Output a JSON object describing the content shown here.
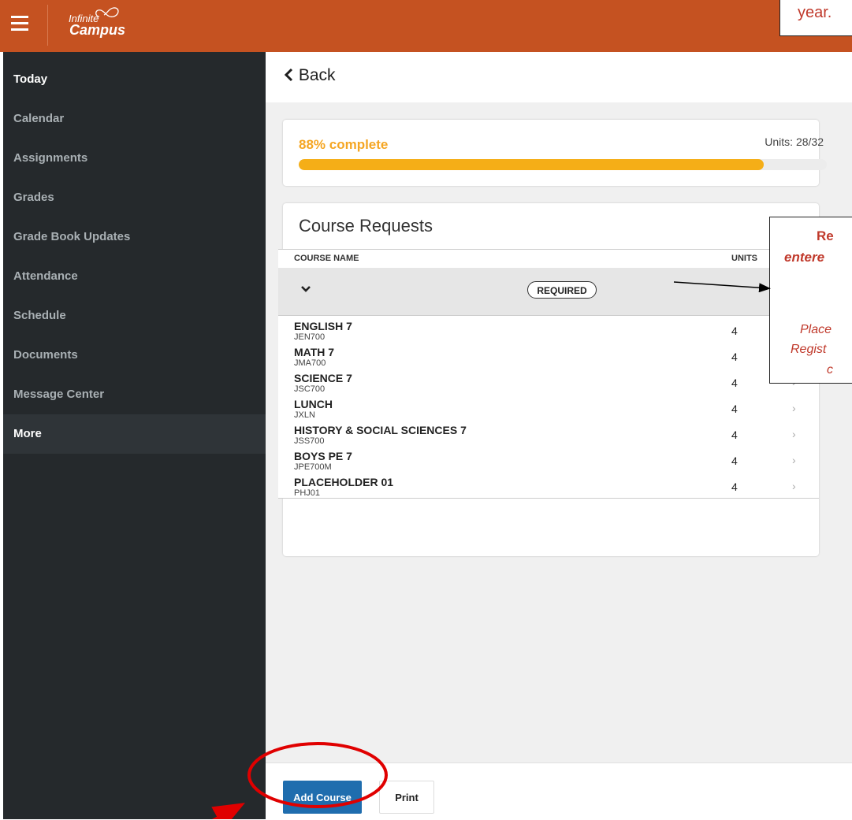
{
  "header": {
    "menu_icon": "hamburger-icon",
    "logo_line1": "Infinite",
    "logo_line2": "Campus",
    "brand_color": "#c55221"
  },
  "sidebar": {
    "items": [
      {
        "label": "Today"
      },
      {
        "label": "Calendar"
      },
      {
        "label": "Assignments"
      },
      {
        "label": "Grades"
      },
      {
        "label": "Grade Book Updates"
      },
      {
        "label": "Attendance"
      },
      {
        "label": "Schedule"
      },
      {
        "label": "Documents"
      },
      {
        "label": "Message Center"
      },
      {
        "label": "More"
      }
    ]
  },
  "back_label": "Back",
  "progress": {
    "percent_label": "88% complete",
    "units_label": "Units: 28/32",
    "fraction": 0.88
  },
  "requests": {
    "title": "Course Requests",
    "col_course": "COURSE NAME",
    "col_units": "UNITS",
    "group_label": "REQUIRED",
    "courses": [
      {
        "name": "ENGLISH 7",
        "code": "JEN700",
        "units": "4"
      },
      {
        "name": "MATH 7",
        "code": "JMA700",
        "units": "4"
      },
      {
        "name": "SCIENCE 7",
        "code": "JSC700",
        "units": "4"
      },
      {
        "name": "LUNCH",
        "code": "JXLN",
        "units": "4"
      },
      {
        "name": "HISTORY & SOCIAL SCIENCES 7",
        "code": "JSS700",
        "units": "4"
      },
      {
        "name": "BOYS PE 7",
        "code": "JPE700M",
        "units": "4"
      },
      {
        "name": "PLACEHOLDER 01",
        "code": "PHJ01",
        "units": "4"
      }
    ]
  },
  "buttons": {
    "add_course": "Add Course",
    "print": "Print"
  },
  "annotations": {
    "top_callout": "year.",
    "right_callout_1": "Re",
    "right_callout_2": "entere",
    "right_callout_3": "Place",
    "right_callout_4": "Regist",
    "right_callout_5": "c"
  },
  "colors": {
    "sidebar_bg": "#25292c",
    "progress_color": "#f5ae17",
    "primary_button": "#1f6dae",
    "annotation_red": "#e00000"
  }
}
